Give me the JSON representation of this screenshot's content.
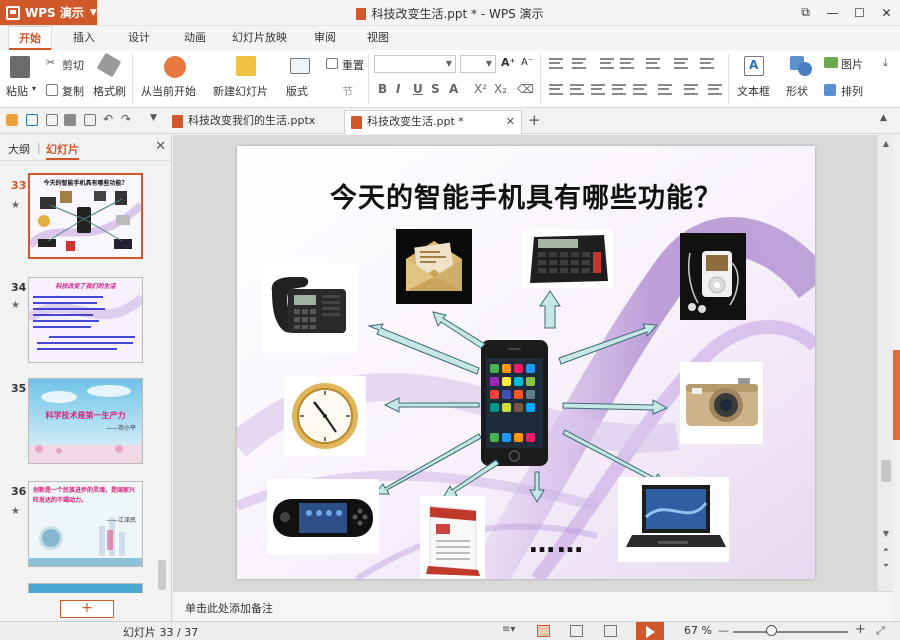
{
  "app": {
    "menu_button": "WPS 演示",
    "window_title": "科技改变生活.ppt * - WPS 演示"
  },
  "menu_tabs": [
    "开始",
    "插入",
    "设计",
    "动画",
    "幻灯片放映",
    "审阅",
    "视图"
  ],
  "ribbon": {
    "cut": "剪切",
    "paste": "粘贴",
    "copy": "复制",
    "format_painter": "格式刷",
    "from_current": "从当前开始",
    "new_slide": "新建幻灯片",
    "layout": "版式",
    "reset": "重置",
    "section": "节",
    "bold": "B",
    "italic": "I",
    "underline": "U",
    "strike": "S",
    "text_box": "文本框",
    "shape": "形状",
    "picture": "图片",
    "arrange": "排列"
  },
  "doc_tabs": [
    {
      "label": "科技改变我们的生活.pptx",
      "active": false
    },
    {
      "label": "科技改变生活.ppt *",
      "active": true
    }
  ],
  "left_panel": {
    "tab_outline": "大纲",
    "tab_slides": "幻灯片",
    "slides": [
      {
        "num": "33",
        "active": true
      },
      {
        "num": "34",
        "active": false
      },
      {
        "num": "35",
        "active": false
      },
      {
        "num": "36",
        "active": false
      }
    ],
    "thumb_texts": {
      "s33_title": "今天的智能手机具有哪些功能？",
      "s34_title": "科技改变了我们的生活",
      "s35_main": "科学技术是第一生产力",
      "s35_author": "——邓小平",
      "s36_main": "创新是一个民族进步的灵魂，是国家兴旺发达的不竭动力。",
      "s36_author": "——江泽民"
    },
    "add_button": "+"
  },
  "slide": {
    "title": "今天的智能手机具有哪些功能？",
    "ellipsis": "……"
  },
  "notes_placeholder": "单击此处添加备注",
  "status": {
    "slide_counter": "幻灯片 33 / 37",
    "zoom": "67 %"
  },
  "colors": {
    "accent": "#d0582a",
    "arrow_fill": "#c7e6e6",
    "arrow_stroke": "#3a6a73"
  }
}
